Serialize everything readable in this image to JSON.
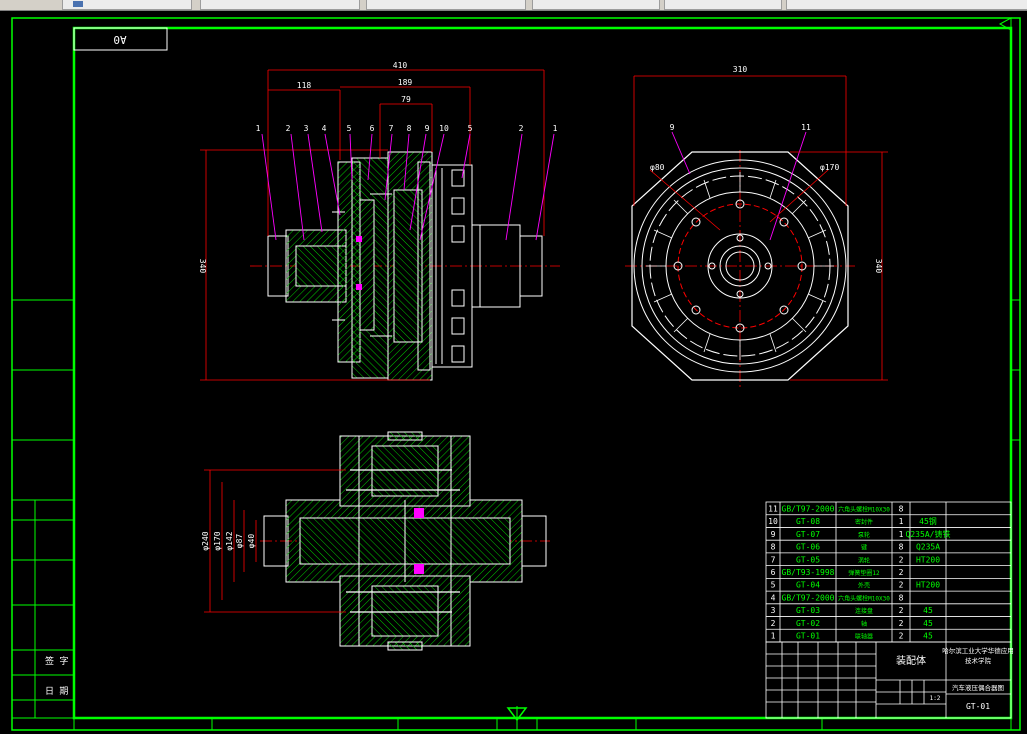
{
  "window": {
    "tabs": [
      "",
      "",
      "",
      "",
      "",
      ""
    ]
  },
  "drawing": {
    "format": "A0",
    "title_block": {
      "assembly_title": "装配体",
      "school_line1": "哈尔滨工业大学华德应用",
      "school_line2": "技术学院",
      "drawing_title": "汽车液压偶合器图",
      "drawing_number": "GT-01",
      "scale_value": "1:2"
    },
    "parts": [
      {
        "no": "11",
        "code": "GB/T97-2000",
        "name": "六角头螺栓M10X30",
        "qty": "8",
        "material": ""
      },
      {
        "no": "10",
        "code": "GT-08",
        "name": "密封件",
        "qty": "1",
        "material": "45钢"
      },
      {
        "no": "9",
        "code": "GT-07",
        "name": "泵轮",
        "qty": "1",
        "material": "Q235A/铸铁"
      },
      {
        "no": "8",
        "code": "GT-06",
        "name": "键",
        "qty": "8",
        "material": "Q235A"
      },
      {
        "no": "7",
        "code": "GT-05",
        "name": "涡轮",
        "qty": "2",
        "material": "HT200"
      },
      {
        "no": "6",
        "code": "GB/T93-1998",
        "name": "弹簧垫圈12",
        "qty": "2",
        "material": ""
      },
      {
        "no": "5",
        "code": "GT-04",
        "name": "外壳",
        "qty": "2",
        "material": "HT200"
      },
      {
        "no": "4",
        "code": "GB/T97-2000",
        "name": "六角头螺栓M10X30",
        "qty": "8",
        "material": ""
      },
      {
        "no": "3",
        "code": "GT-03",
        "name": "连接盘",
        "qty": "2",
        "material": "45"
      },
      {
        "no": "2",
        "code": "GT-02",
        "name": "轴",
        "qty": "2",
        "material": "45"
      },
      {
        "no": "1",
        "code": "GT-01",
        "name": "联轴器",
        "qty": "2",
        "material": "45"
      }
    ],
    "front_view": {
      "dims": {
        "overall_length": "410",
        "left": "118",
        "mid": "189",
        "inner": "79",
        "height": "340"
      },
      "balloons": [
        "1",
        "2",
        "3",
        "4",
        "5",
        "6",
        "7",
        "8",
        "9",
        "10",
        "5",
        "2",
        "1"
      ]
    },
    "side_view": {
      "dims": {
        "width": "310",
        "height": "340",
        "dia_left": "φ80",
        "dia_right": "φ170"
      },
      "balloons": [
        "9",
        "11"
      ]
    },
    "bottom_view": {
      "dims": [
        "φ240",
        "φ170",
        "φ142",
        "φ87",
        "φ40"
      ]
    },
    "left_labels": {
      "sign": "签 字",
      "date": "日 期"
    }
  },
  "colors": {
    "border": "#00ff00",
    "outline": "#ffffff",
    "dim": "#ff0000",
    "leader": "#ff00ff",
    "hatch": "#00ff00",
    "text": "#ffffff",
    "table_text": "#00ff00"
  }
}
